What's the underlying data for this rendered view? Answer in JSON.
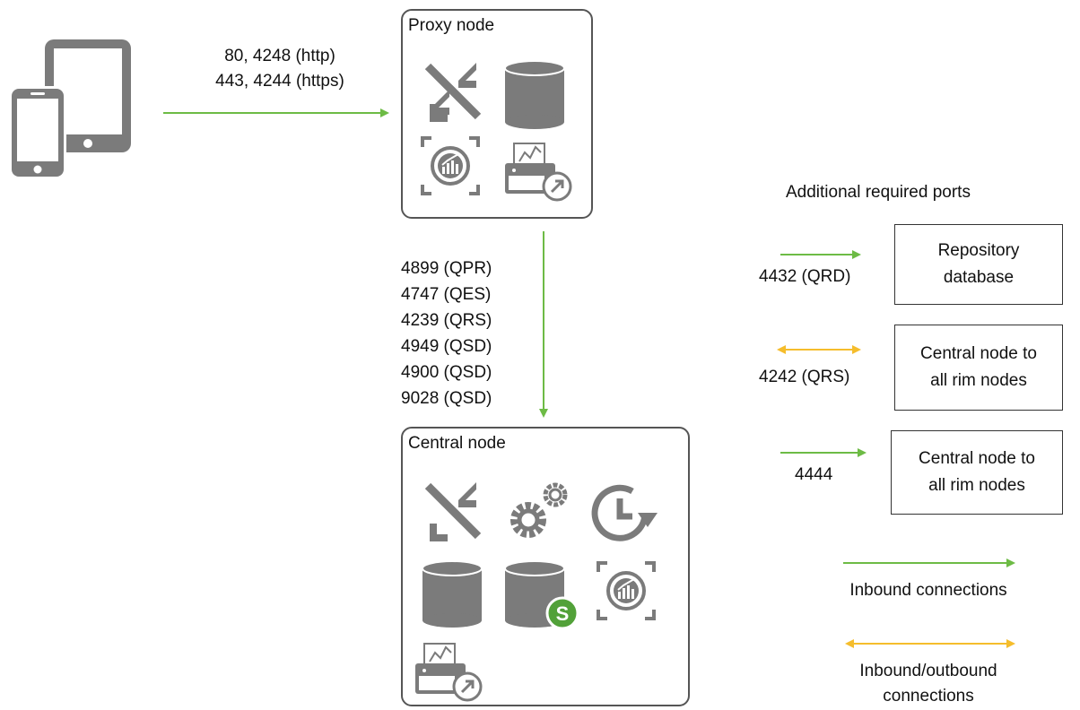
{
  "proxy_node": {
    "title": "Proxy node",
    "client_ports": [
      "80, 4248 (http)",
      "443, 4244 (https)"
    ],
    "icons": [
      "proxy-service-icon",
      "database-icon",
      "engine-icon",
      "printing-service-icon"
    ]
  },
  "central_node": {
    "title": "Central node",
    "icons": [
      "proxy-service-icon",
      "repository-service-gears-icon",
      "scheduler-service-icon",
      "database-icon",
      "database-s-icon",
      "engine-icon",
      "printing-service-icon"
    ]
  },
  "proxy_to_central_ports": [
    "4899 (QPR)",
    "4747 (QES)",
    "4239 (QRS)",
    "4949 (QSD)",
    "4900 (QSD)",
    "9028 (QSD)"
  ],
  "additional": {
    "heading": "Additional required ports",
    "rows": [
      {
        "port": "4432 (QRD)",
        "box": [
          "Repository",
          "database"
        ],
        "arrow": "inbound"
      },
      {
        "port": "4242 (QRS)",
        "box": [
          "Central node to",
          "all rim nodes"
        ],
        "arrow": "inbound-outbound"
      },
      {
        "port": "4444",
        "box": [
          "Central node to",
          "all rim nodes"
        ],
        "arrow": "inbound"
      }
    ]
  },
  "legend": {
    "inbound": "Inbound connections",
    "inbound_outbound": [
      "Inbound/outbound",
      "connections"
    ]
  },
  "colors": {
    "green": "#6dbb45",
    "yellow": "#f5bd2c",
    "icon_gray": "#7b7b7b",
    "qlik_green": "#52a139"
  }
}
